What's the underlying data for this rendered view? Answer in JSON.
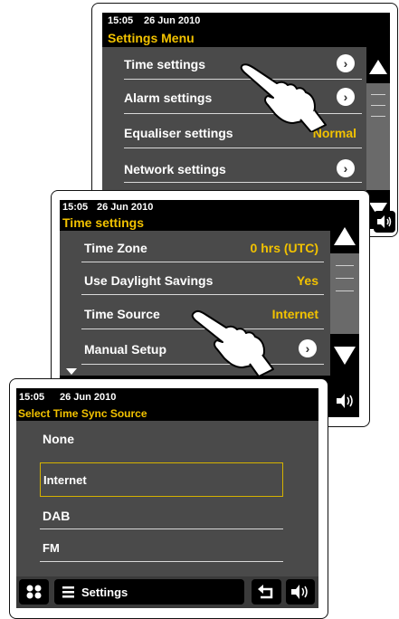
{
  "panel1": {
    "status": {
      "time": "15:05",
      "date": "26 Jun 2010"
    },
    "title": "Settings Menu",
    "items": [
      {
        "label": "Time settings",
        "value": ""
      },
      {
        "label": "Alarm settings",
        "value": ""
      },
      {
        "label": "Equaliser settings",
        "value": "Normal"
      },
      {
        "label": "Network settings",
        "value": ""
      }
    ]
  },
  "panel2": {
    "status": {
      "time": "15:05",
      "date": "26 Jun 2010"
    },
    "title": "Time settings",
    "items": [
      {
        "label": "Time Zone",
        "value": "0 hrs (UTC)"
      },
      {
        "label": "Use Daylight Savings",
        "value": "Yes"
      },
      {
        "label": "Time Source",
        "value": "Internet"
      },
      {
        "label": "Manual Setup",
        "value": ""
      }
    ]
  },
  "panel3": {
    "status": {
      "time": "15:05",
      "date": "26 Jun 2010"
    },
    "title": "Select Time Sync Source",
    "options": [
      {
        "label": "None",
        "selected": false
      },
      {
        "label": "Internet",
        "selected": true
      },
      {
        "label": "DAB",
        "selected": false
      },
      {
        "label": "FM",
        "selected": false
      }
    ],
    "bottom": {
      "settings_label": "Settings"
    }
  },
  "colors": {
    "accent": "#f2c200",
    "screen": "#4a4a4a",
    "bar": "#000000"
  },
  "icons": [
    "chevron-right-icon",
    "up-arrow-icon",
    "down-arrow-icon",
    "volume-icon",
    "grid-icon",
    "menu-icon",
    "back-icon",
    "pointing-hand-icon"
  ]
}
